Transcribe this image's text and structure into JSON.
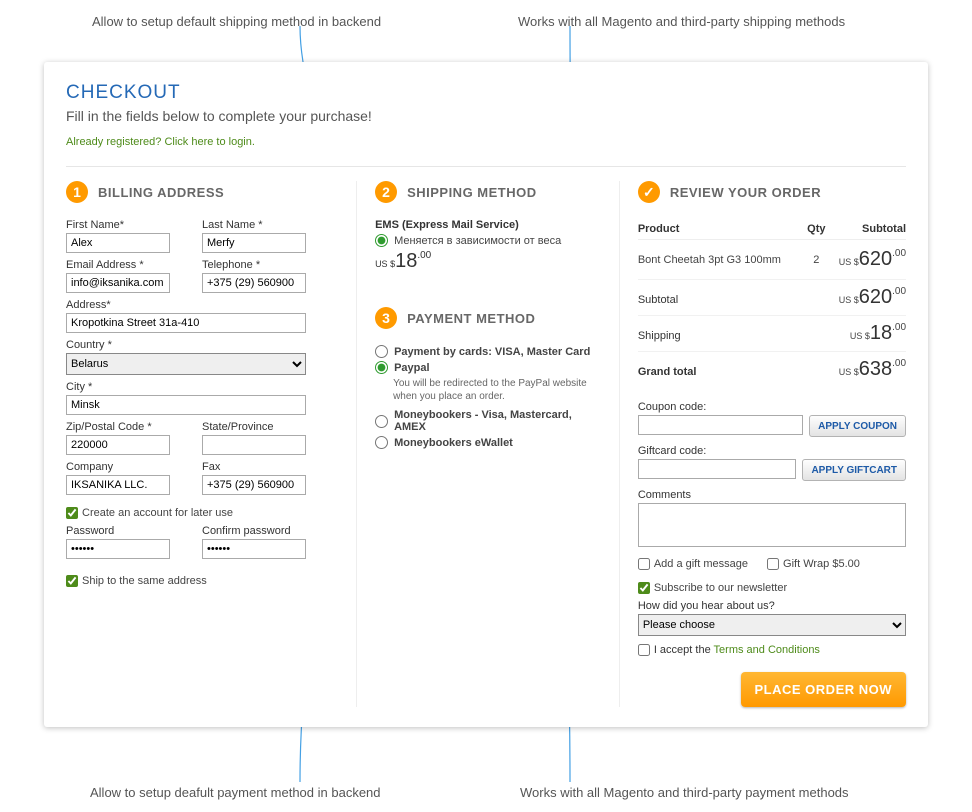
{
  "annotations": {
    "top_left": "Allow to setup default shipping method in backend",
    "top_right": "Works with all Magento and third-party shipping methods",
    "bottom_left": "Allow to setup deafult payment method in backend",
    "bottom_right": "Works with all Magento and third-party payment methods"
  },
  "header": {
    "title": "CHECKOUT",
    "subtitle": "Fill in the fields below to complete your purchase!",
    "login_text": "Already registered? Click here to login."
  },
  "billing": {
    "title": "BILLING ADDRESS",
    "labels": {
      "first_name": "First Name*",
      "last_name": "Last Name *",
      "email": "Email Address *",
      "telephone": "Telephone *",
      "address": "Address*",
      "country": "Country *",
      "city": "City *",
      "zip": "Zip/Postal Code *",
      "state": "State/Province",
      "company": "Company",
      "fax": "Fax",
      "create_account": "Create an account for later use",
      "password": "Password",
      "confirm": "Confirm password",
      "same_address": "Ship to the same address"
    },
    "values": {
      "first_name": "Alex",
      "last_name": "Merfy",
      "email": "info@iksanika.com",
      "telephone": "+375 (29) 560900",
      "address": "Kropotkina Street 31a-410",
      "country": "Belarus",
      "city": "Minsk",
      "zip": "220000",
      "state": "",
      "company": "IKSANIKA LLC.",
      "fax": "+375 (29) 560900",
      "password": "••••••",
      "confirm": "••••••"
    }
  },
  "shipping": {
    "title": "SHIPPING METHOD",
    "method_name": "EMS (Express Mail Service)",
    "option_label": "Меняется в зависимости от веса",
    "currency": "US $",
    "price_int": "18",
    "price_dec": ".00"
  },
  "payment": {
    "title": "PAYMENT METHOD",
    "options": {
      "card": "Payment by cards: VISA, Master Card",
      "paypal": "Paypal",
      "paypal_note": "You will be redirected to the PayPal website when you place an order.",
      "mb_card": "Moneybookers - Visa, Mastercard, AMEX",
      "mb_wallet": "Moneybookers eWallet"
    }
  },
  "review": {
    "title": "REVIEW YOUR ORDER",
    "headers": {
      "product": "Product",
      "qty": "Qty",
      "subtotal": "Subtotal"
    },
    "item": {
      "name": "Bont Cheetah 3pt G3 100mm",
      "qty": "2",
      "amt_int": "620",
      "amt_dec": ".00"
    },
    "totals": {
      "subtotal_label": "Subtotal",
      "subtotal_int": "620",
      "subtotal_dec": ".00",
      "shipping_label": "Shipping",
      "shipping_int": "18",
      "shipping_dec": ".00",
      "grand_label": "Grand total",
      "grand_int": "638",
      "grand_dec": ".00"
    },
    "coupon_label": "Coupon code:",
    "apply_coupon": "APPLY COUPON",
    "gift_label": "Giftcard code:",
    "apply_gift": "APPLY GIFTCART",
    "comments_label": "Comments",
    "checks": {
      "gift_msg": "Add a gift message",
      "gift_wrap": "Gift Wrap $5.00",
      "newsletter": "Subscribe to our newsletter"
    },
    "hear_label": "How did you hear about us?",
    "hear_selected": "Please choose",
    "accept_prefix": "I accept the ",
    "accept_link": "Terms and Conditions",
    "cta": "PLACE ORDER NOW",
    "currency": "US $"
  }
}
